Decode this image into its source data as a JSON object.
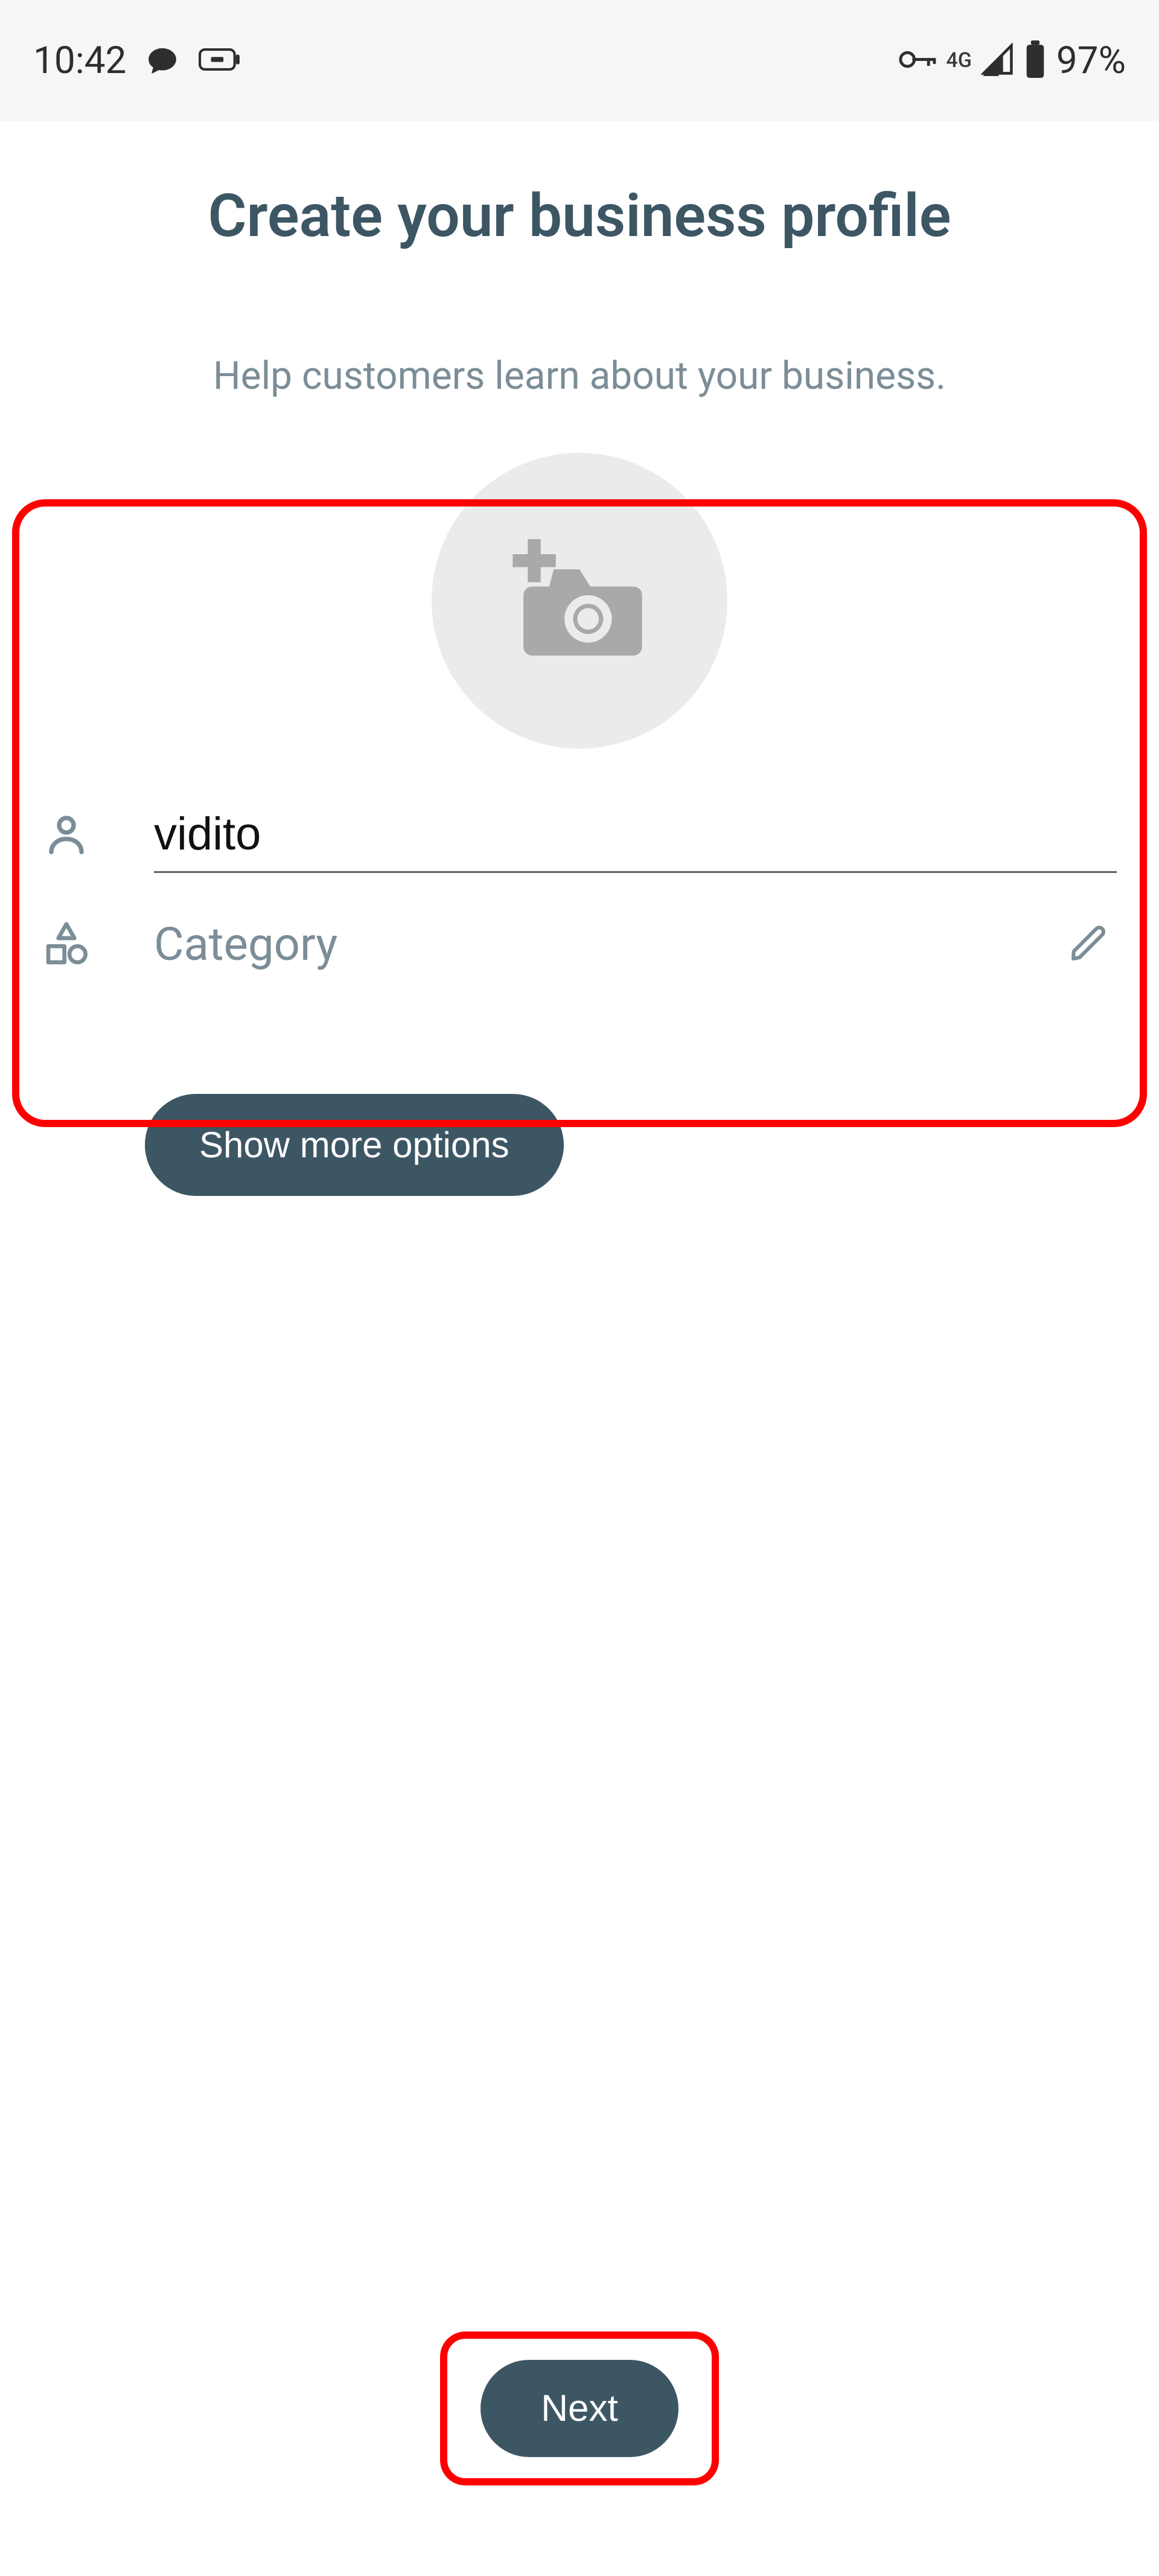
{
  "status_bar": {
    "time": "10:42",
    "network_label": "4G",
    "battery_percent": "97%"
  },
  "page": {
    "title": "Create your business profile",
    "subtitle": "Help customers learn about your business."
  },
  "form": {
    "name_value": "vidito",
    "category_label": "Category"
  },
  "buttons": {
    "show_more": "Show more options",
    "next": "Next"
  },
  "icon_names": {
    "chat": "chat-bubble-icon",
    "battery_small": "battery-indicator-icon",
    "key": "vpn-key-icon",
    "signal": "signal-icon",
    "battery": "battery-icon",
    "camera": "add-photo-icon",
    "person": "person-icon",
    "shapes": "category-shapes-icon",
    "pencil": "pencil-icon"
  }
}
